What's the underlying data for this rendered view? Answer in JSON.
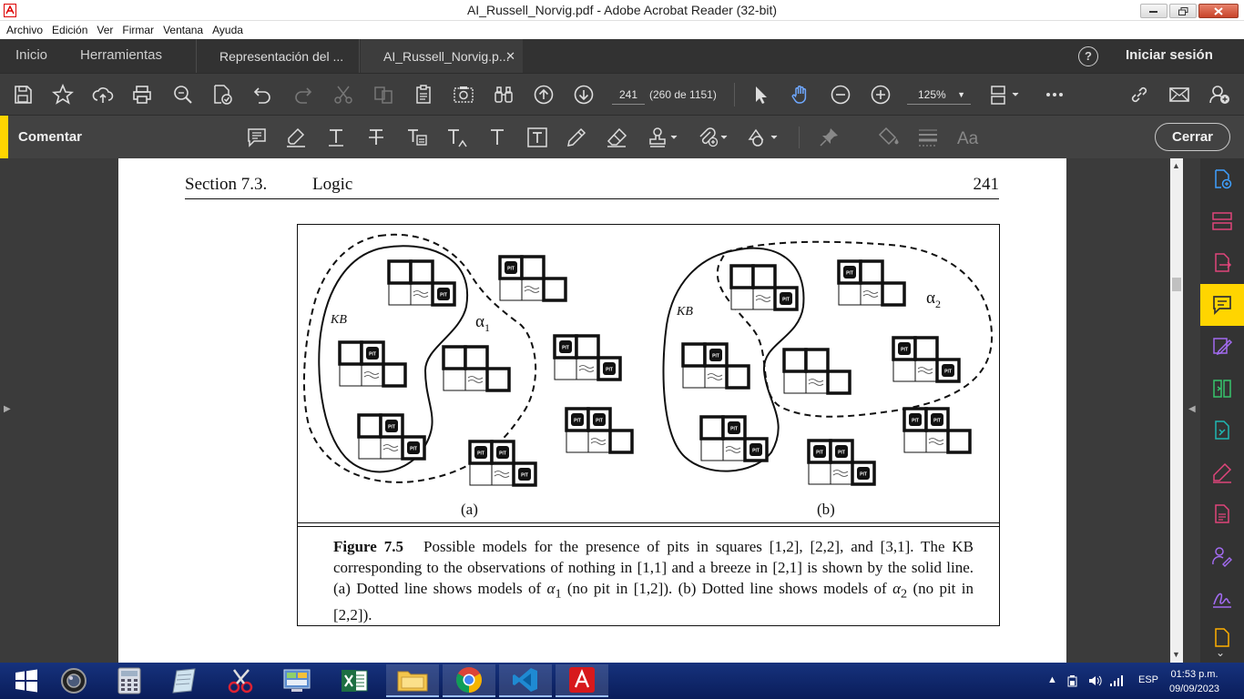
{
  "window": {
    "title": "AI_Russell_Norvig.pdf - Adobe Acrobat Reader (32-bit)"
  },
  "menubar": {
    "items": [
      "Archivo",
      "Edición",
      "Ver",
      "Firmar",
      "Ventana",
      "Ayuda"
    ]
  },
  "tabs": {
    "home": "Inicio",
    "tools": "Herramientas",
    "documents": [
      {
        "label": "Representación del ...",
        "active": false
      },
      {
        "label": "AI_Russell_Norvig.p...",
        "active": true
      }
    ],
    "help": "?",
    "sign_in": "Iniciar sesión"
  },
  "toolbar": {
    "page_current": "241",
    "page_count": "(260 de 1151)",
    "zoom": "125%",
    "icons": [
      "save-icon",
      "bookmark-star-icon",
      "upload-cloud-icon",
      "print-icon",
      "search-zoom-icon",
      "edit-pdf-icon",
      "undo-icon",
      "redo-icon",
      "cut-icon",
      "copy-icon",
      "paste-icon",
      "snapshot-icon",
      "find-binoculars-icon",
      "page-up-icon",
      "page-down-icon",
      "select-cursor-icon",
      "hand-tool-icon",
      "zoom-out-icon",
      "zoom-in-icon",
      "page-layout-icon",
      "more-icon",
      "share-link-icon",
      "email-icon",
      "add-user-icon"
    ]
  },
  "commentbar": {
    "label": "Comentar",
    "close": "Cerrar",
    "icons": [
      "sticky-note-icon",
      "highlight-icon",
      "text-underline-icon",
      "strikethrough-icon",
      "replace-text-icon",
      "insert-text-icon",
      "add-text-icon",
      "text-box-icon",
      "pencil-icon",
      "eraser-icon",
      "stamp-icon",
      "attach-icon",
      "shapes-icon",
      "pin-icon",
      "fill-color-icon",
      "line-weight-icon",
      "font-size-icon"
    ]
  },
  "page": {
    "section": "Section 7.3.",
    "topic": "Logic",
    "page_number": "241",
    "figure": {
      "labels": {
        "kb": "KB",
        "alpha": "α",
        "alpha1_sub": "1",
        "alpha2_sub": "2",
        "pit": "PIT"
      },
      "sub_a": "(a)",
      "sub_b": "(b)",
      "caption_number": "Figure 7.5",
      "caption_part1": "Possible models for the presence of pits in squares [1,2], [2,2], and [3,1]. The KB corresponding to the observations of nothing in [1,1] and a breeze in [2,1] is shown by the solid line.  (a) Dotted line shows models of ",
      "caption_alpha1": "α",
      "caption_sub1": "1",
      "caption_part2": " (no pit in [1,2]).  (b) Dotted line shows models of ",
      "caption_alpha2": "α",
      "caption_sub2": "2",
      "caption_part3": " (no pit in [2,2])."
    }
  },
  "rightpanel": {
    "icons": [
      "create-pdf-icon",
      "organize-pages-icon",
      "export-pdf-icon",
      "comment-icon",
      "edit-pdf-icon",
      "compress-icon",
      "convert-icon",
      "fill-sign-icon",
      "protect-icon",
      "request-signature-icon",
      "sign-icon",
      "more-tools-icon"
    ]
  },
  "taskbar": {
    "apps": [
      "start-icon",
      "camera-app-icon",
      "calculator-icon",
      "notes-icon",
      "snipping-tool-icon",
      "control-panel-icon",
      "excel-icon",
      "file-explorer-icon",
      "chrome-icon",
      "vscode-icon",
      "acrobat-icon"
    ],
    "language": "ESP",
    "time": "01:53 p.m.",
    "date": "09/09/2023"
  },
  "colors": {
    "accent_yellow": "#ffd500",
    "toolbar_bg": "#3d3d3d",
    "taskbar_bg": "#0f2868",
    "hand_tool_blue": "#6fa8ff"
  }
}
